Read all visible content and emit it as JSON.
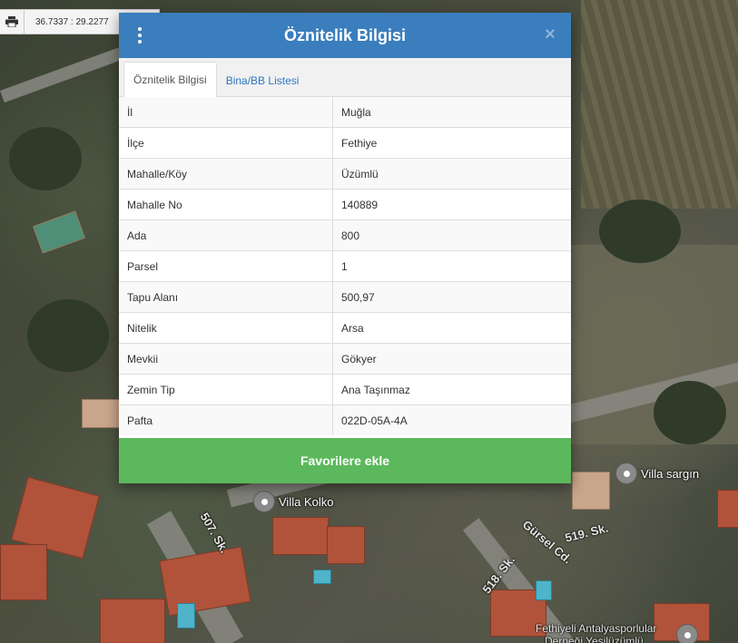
{
  "toolbar": {
    "print_icon": "print-icon",
    "coordinates": "36.7337 : 29.2277"
  },
  "dialog": {
    "title": "Öznitelik Bilgisi",
    "menu_icon": "kebab-menu-icon",
    "close_label": "×",
    "tabs": [
      {
        "label": "Öznitelik Bilgisi",
        "active": true
      },
      {
        "label": "Bina/BB Listesi",
        "active": false
      }
    ],
    "rows": [
      {
        "key": "İl",
        "value": "Muğla"
      },
      {
        "key": "İlçe",
        "value": "Fethiye"
      },
      {
        "key": "Mahalle/Köy",
        "value": "Üzümlü"
      },
      {
        "key": "Mahalle No",
        "value": "140889"
      },
      {
        "key": "Ada",
        "value": "800"
      },
      {
        "key": "Parsel",
        "value": "1"
      },
      {
        "key": "Tapu Alanı",
        "value": "500,97"
      },
      {
        "key": "Nitelik",
        "value": "Arsa"
      },
      {
        "key": "Mevkii",
        "value": "Gökyer"
      },
      {
        "key": "Zemin Tip",
        "value": "Ana Taşınmaz"
      },
      {
        "key": "Pafta",
        "value": "022D-05A-4A"
      }
    ],
    "favorite_button": "Favorilere ekle"
  },
  "map": {
    "poi_villa_sargin": "Villa sargın",
    "poi_villa_kolko": "Villa Kolko",
    "road_507": "507. Sk.",
    "road_518": "518. Sk.",
    "road_519": "519. Sk.",
    "road_gursel": "Gürsel Cd.",
    "poi_fethiyeli": "Fethiyeli Antalyasporlular",
    "poi_dernegi": "Derneği Yeşilüzümlü"
  },
  "colors": {
    "header": "#3a7ebd",
    "favorite_button": "#5cb85c",
    "tab_link": "#2f78c0"
  }
}
